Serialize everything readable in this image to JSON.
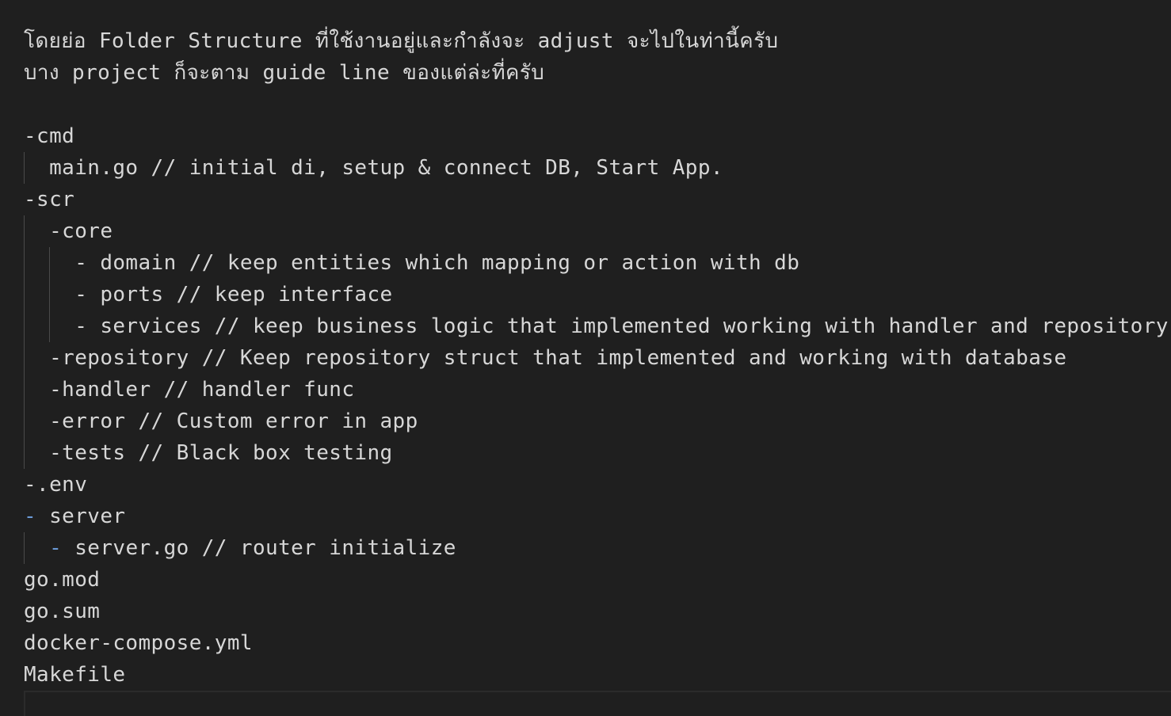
{
  "lines": [
    "โดยย่อ Folder Structure ที่ใช้งานอยู่และกำลังจะ adjust จะไปในท่านี้ครับ",
    "บาง project ก็จะตาม guide line ของแต่ล่ะที่ครับ",
    "",
    "-cmd",
    "  main.go // initial di, setup & connect DB, Start App.",
    "-scr",
    "  -core",
    "    - domain // keep entities which mapping or action with db",
    "    - ports // keep interface",
    "    - services // keep business logic that implemented working with handler and repository",
    "  -repository // Keep repository struct that implemented and working with database",
    "  -handler // handler func",
    "  -error // Custom error in app",
    "  -tests // Black box testing",
    "-.env",
    "- server",
    "  - server.go // router initialize",
    "go.mod",
    "go.sum",
    "docker-compose.yml",
    "Makefile"
  ],
  "server_line": {
    "dash": "-",
    "text": " server"
  },
  "server_go_line": {
    "indent": "  ",
    "dash": "-",
    "text": " server.go // router initialize"
  },
  "colors": {
    "background": "#1f1f1f",
    "text": "#d7d7d7",
    "accent_dash": "#6b9bd8",
    "indent_guide": "#4a4a4a"
  }
}
